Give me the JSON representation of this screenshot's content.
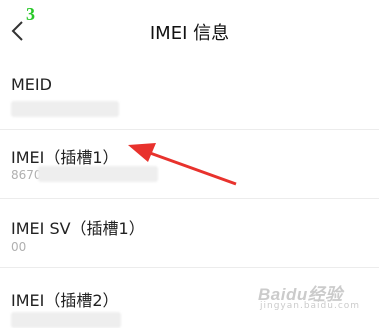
{
  "header": {
    "step_number": "3",
    "title": "IMEI 信息"
  },
  "rows": [
    {
      "label": "MEID",
      "value": ""
    },
    {
      "label": "IMEI（插槽1）",
      "value": "86706"
    },
    {
      "label": "IMEI SV（插槽1）",
      "value": "00"
    },
    {
      "label": "IMEI（插槽2）",
      "value": ""
    }
  ],
  "watermark": {
    "logo": "Baidu经验",
    "sub": "jingyan.baidu.com"
  },
  "colors": {
    "annotation_arrow": "#e8322d",
    "step_number": "#28c828"
  }
}
